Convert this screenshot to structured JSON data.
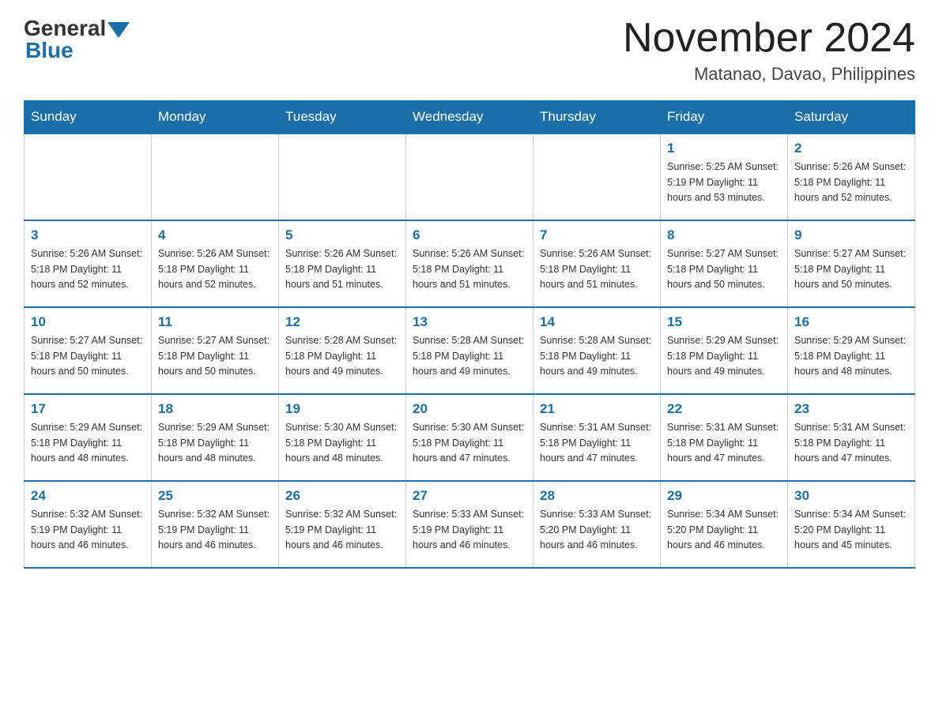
{
  "header": {
    "logo_general": "General",
    "logo_blue": "Blue",
    "month_title": "November 2024",
    "location": "Matanao, Davao, Philippines"
  },
  "weekdays": [
    "Sunday",
    "Monday",
    "Tuesday",
    "Wednesday",
    "Thursday",
    "Friday",
    "Saturday"
  ],
  "weeks": [
    [
      {
        "day": "",
        "info": ""
      },
      {
        "day": "",
        "info": ""
      },
      {
        "day": "",
        "info": ""
      },
      {
        "day": "",
        "info": ""
      },
      {
        "day": "",
        "info": ""
      },
      {
        "day": "1",
        "info": "Sunrise: 5:25 AM\nSunset: 5:19 PM\nDaylight: 11 hours\nand 53 minutes."
      },
      {
        "day": "2",
        "info": "Sunrise: 5:26 AM\nSunset: 5:18 PM\nDaylight: 11 hours\nand 52 minutes."
      }
    ],
    [
      {
        "day": "3",
        "info": "Sunrise: 5:26 AM\nSunset: 5:18 PM\nDaylight: 11 hours\nand 52 minutes."
      },
      {
        "day": "4",
        "info": "Sunrise: 5:26 AM\nSunset: 5:18 PM\nDaylight: 11 hours\nand 52 minutes."
      },
      {
        "day": "5",
        "info": "Sunrise: 5:26 AM\nSunset: 5:18 PM\nDaylight: 11 hours\nand 51 minutes."
      },
      {
        "day": "6",
        "info": "Sunrise: 5:26 AM\nSunset: 5:18 PM\nDaylight: 11 hours\nand 51 minutes."
      },
      {
        "day": "7",
        "info": "Sunrise: 5:26 AM\nSunset: 5:18 PM\nDaylight: 11 hours\nand 51 minutes."
      },
      {
        "day": "8",
        "info": "Sunrise: 5:27 AM\nSunset: 5:18 PM\nDaylight: 11 hours\nand 50 minutes."
      },
      {
        "day": "9",
        "info": "Sunrise: 5:27 AM\nSunset: 5:18 PM\nDaylight: 11 hours\nand 50 minutes."
      }
    ],
    [
      {
        "day": "10",
        "info": "Sunrise: 5:27 AM\nSunset: 5:18 PM\nDaylight: 11 hours\nand 50 minutes."
      },
      {
        "day": "11",
        "info": "Sunrise: 5:27 AM\nSunset: 5:18 PM\nDaylight: 11 hours\nand 50 minutes."
      },
      {
        "day": "12",
        "info": "Sunrise: 5:28 AM\nSunset: 5:18 PM\nDaylight: 11 hours\nand 49 minutes."
      },
      {
        "day": "13",
        "info": "Sunrise: 5:28 AM\nSunset: 5:18 PM\nDaylight: 11 hours\nand 49 minutes."
      },
      {
        "day": "14",
        "info": "Sunrise: 5:28 AM\nSunset: 5:18 PM\nDaylight: 11 hours\nand 49 minutes."
      },
      {
        "day": "15",
        "info": "Sunrise: 5:29 AM\nSunset: 5:18 PM\nDaylight: 11 hours\nand 49 minutes."
      },
      {
        "day": "16",
        "info": "Sunrise: 5:29 AM\nSunset: 5:18 PM\nDaylight: 11 hours\nand 48 minutes."
      }
    ],
    [
      {
        "day": "17",
        "info": "Sunrise: 5:29 AM\nSunset: 5:18 PM\nDaylight: 11 hours\nand 48 minutes."
      },
      {
        "day": "18",
        "info": "Sunrise: 5:29 AM\nSunset: 5:18 PM\nDaylight: 11 hours\nand 48 minutes."
      },
      {
        "day": "19",
        "info": "Sunrise: 5:30 AM\nSunset: 5:18 PM\nDaylight: 11 hours\nand 48 minutes."
      },
      {
        "day": "20",
        "info": "Sunrise: 5:30 AM\nSunset: 5:18 PM\nDaylight: 11 hours\nand 47 minutes."
      },
      {
        "day": "21",
        "info": "Sunrise: 5:31 AM\nSunset: 5:18 PM\nDaylight: 11 hours\nand 47 minutes."
      },
      {
        "day": "22",
        "info": "Sunrise: 5:31 AM\nSunset: 5:18 PM\nDaylight: 11 hours\nand 47 minutes."
      },
      {
        "day": "23",
        "info": "Sunrise: 5:31 AM\nSunset: 5:18 PM\nDaylight: 11 hours\nand 47 minutes."
      }
    ],
    [
      {
        "day": "24",
        "info": "Sunrise: 5:32 AM\nSunset: 5:19 PM\nDaylight: 11 hours\nand 46 minutes."
      },
      {
        "day": "25",
        "info": "Sunrise: 5:32 AM\nSunset: 5:19 PM\nDaylight: 11 hours\nand 46 minutes."
      },
      {
        "day": "26",
        "info": "Sunrise: 5:32 AM\nSunset: 5:19 PM\nDaylight: 11 hours\nand 46 minutes."
      },
      {
        "day": "27",
        "info": "Sunrise: 5:33 AM\nSunset: 5:19 PM\nDaylight: 11 hours\nand 46 minutes."
      },
      {
        "day": "28",
        "info": "Sunrise: 5:33 AM\nSunset: 5:20 PM\nDaylight: 11 hours\nand 46 minutes."
      },
      {
        "day": "29",
        "info": "Sunrise: 5:34 AM\nSunset: 5:20 PM\nDaylight: 11 hours\nand 46 minutes."
      },
      {
        "day": "30",
        "info": "Sunrise: 5:34 AM\nSunset: 5:20 PM\nDaylight: 11 hours\nand 45 minutes."
      }
    ]
  ]
}
